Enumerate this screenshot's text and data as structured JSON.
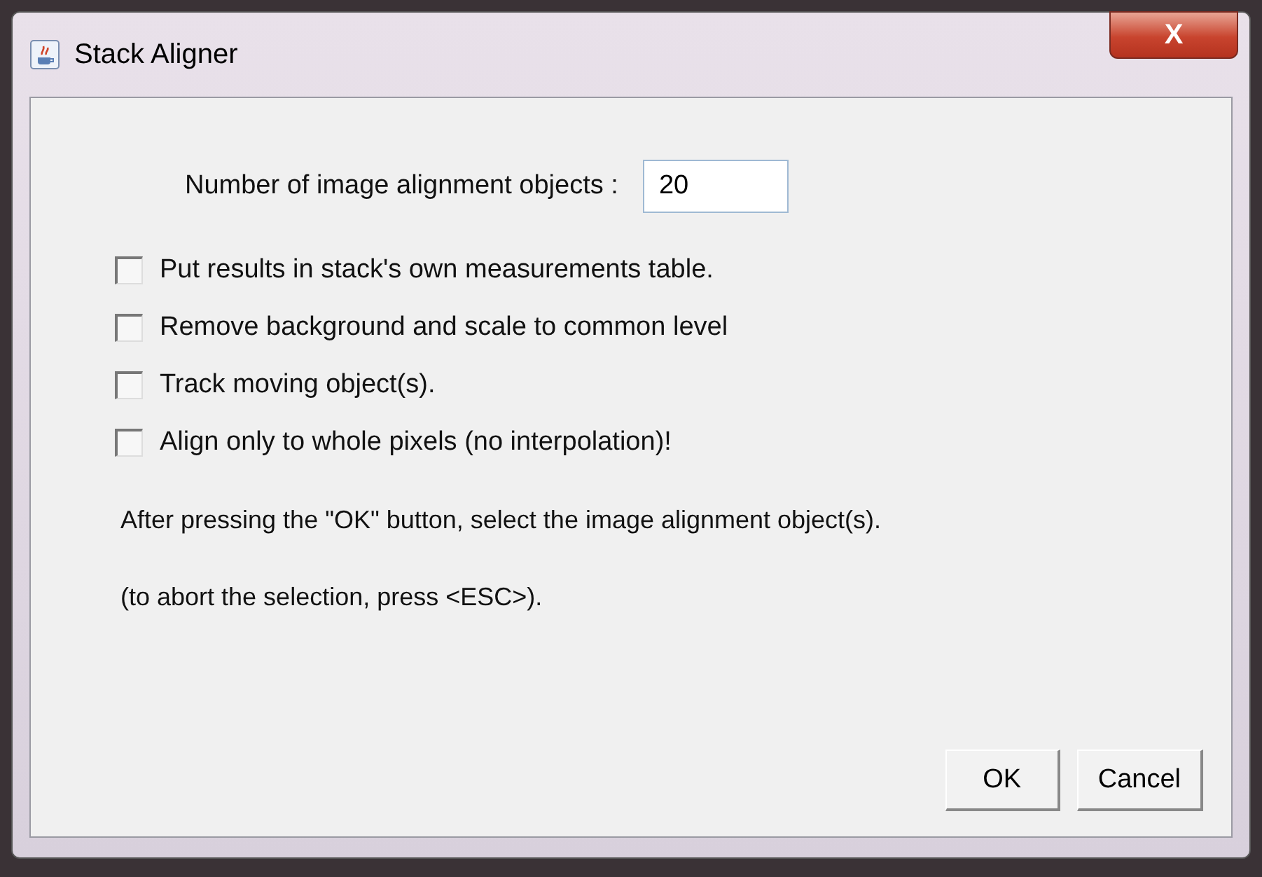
{
  "window": {
    "title": "Stack Aligner",
    "close": "X"
  },
  "field": {
    "label": "Number of image alignment objects :",
    "value": "20"
  },
  "options": [
    {
      "label": "Put results in stack's own measurements table.",
      "checked": false
    },
    {
      "label": "Remove background and scale to common level",
      "checked": false
    },
    {
      "label": "Track moving object(s).",
      "checked": false
    },
    {
      "label": "Align only to whole pixels (no interpolation)!",
      "checked": false
    }
  ],
  "messages": [
    "After pressing the \"OK\" button, select the image alignment object(s).",
    "(to abort the selection, press <ESC>)."
  ],
  "buttons": [
    "OK",
    "Cancel"
  ]
}
